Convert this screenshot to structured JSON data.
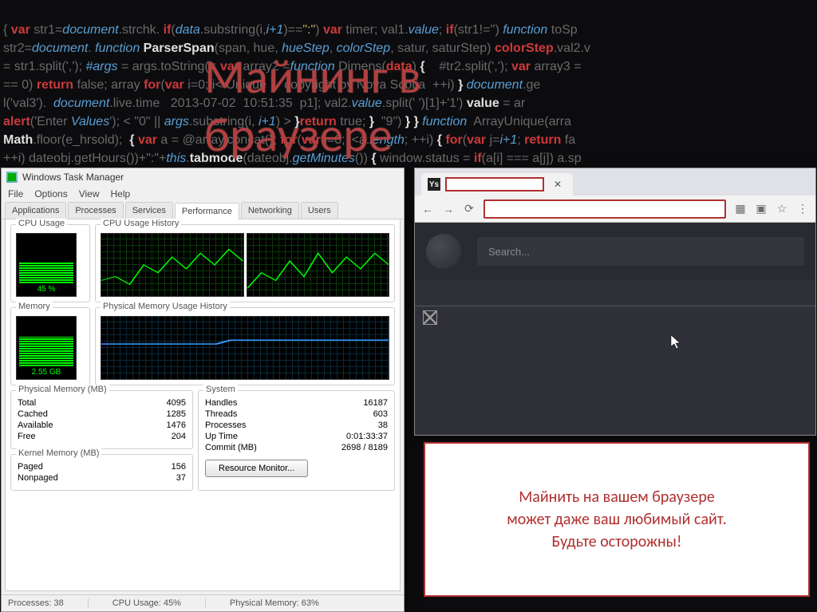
{
  "title": "Майнинг в браузере",
  "code_bg_lines": [
    "{ var str1=document.strchk. if(data.substring(i,i+1)==\":\") var timer; val1.value; if(str1!='') function toSp",
    "str2=document. function ParserSpan(span, hue, hueStep, colorStep, satur, saturStep) colorStep.val2.v",
    "= str1.split(','); #args = args.toString(); var array2 =function Dimens(data) {    #tr2.split(','); var array3 =",
    "== 0) return false; array for(var i=0; i<Unique $    copyright by Nova Scotia ++i) } document.ge",
    "l('val3').  document.live.time   2013-07-02  10:51:35  p1]; val2.value.split(' ')[1]+'1') value = ar",
    "alert('Enter Values'); < \"0\" || args.substring(i, i+1) > }return true; }  \"9\") } } function ArrayUnique(arra",
    "Math.floor(e_hrsold);  { var a = @array.concat(); for(var i=0; i<a.length; ++i) { for(var j=i+1; return fa",
    "++i) dateobj.getHours())+\":\"+this.tabmode(dateobj.getMinutes()) { window.status = if(a[i] === a[j]) a.sp"
  ],
  "task_manager": {
    "window_title": "Windows Task Manager",
    "menu": [
      "File",
      "Options",
      "View",
      "Help"
    ],
    "tabs": [
      "Applications",
      "Processes",
      "Services",
      "Performance",
      "Networking",
      "Users"
    ],
    "active_tab": "Performance",
    "groups": {
      "cpu_usage": {
        "label": "CPU Usage",
        "value": "45 %"
      },
      "cpu_history": {
        "label": "CPU Usage History"
      },
      "memory": {
        "label": "Memory",
        "value": "2.55 GB"
      },
      "mem_history": {
        "label": "Physical Memory Usage History"
      }
    },
    "physical_memory": {
      "label": "Physical Memory (MB)",
      "rows": [
        {
          "k": "Total",
          "v": "4095"
        },
        {
          "k": "Cached",
          "v": "1285"
        },
        {
          "k": "Available",
          "v": "1476"
        },
        {
          "k": "Free",
          "v": "204"
        }
      ]
    },
    "kernel_memory": {
      "label": "Kernel Memory (MB)",
      "rows": [
        {
          "k": "Paged",
          "v": "156"
        },
        {
          "k": "Nonpaged",
          "v": "37"
        }
      ]
    },
    "system": {
      "label": "System",
      "rows": [
        {
          "k": "Handles",
          "v": "16187"
        },
        {
          "k": "Threads",
          "v": "603"
        },
        {
          "k": "Processes",
          "v": "38"
        },
        {
          "k": "Up Time",
          "v": "0:01:33:37"
        },
        {
          "k": "Commit (MB)",
          "v": "2698 / 8189"
        }
      ]
    },
    "resource_monitor_btn": "Resource Monitor...",
    "status": {
      "processes": "Processes: 38",
      "cpu": "CPU Usage: 45%",
      "mem": "Physical Memory: 63%"
    }
  },
  "browser": {
    "search_placeholder": "Search...",
    "toolbar_icons": [
      "back",
      "forward",
      "reload"
    ],
    "extension_icons": [
      "ext1",
      "ext2",
      "star",
      "menu"
    ]
  },
  "warning": {
    "line1": "Майнить на вашем браузере",
    "line2": "может даже ваш любимый сайт.",
    "line3": "Будьте осторожны!"
  },
  "colors": {
    "accent_red": "#b23030",
    "code_bg": "#0c0c0f"
  }
}
